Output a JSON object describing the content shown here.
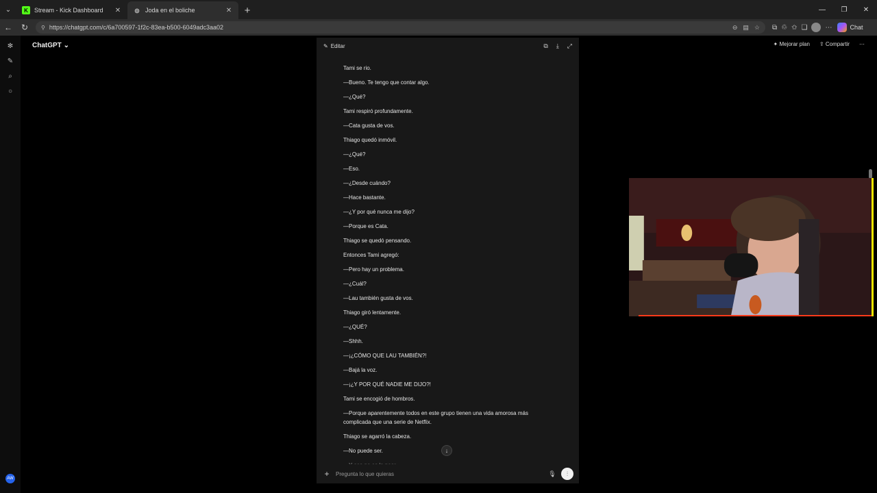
{
  "browser": {
    "tabs": [
      {
        "title": "Stream - Kick Dashboard",
        "favicon": "K",
        "favicon_color": "#53fc18"
      },
      {
        "title": "Joda en el boliche",
        "favicon": "◎",
        "favicon_color": "#d9d9d9"
      }
    ],
    "url": "https://chatgpt.com/c/6a700597-1f2c-83ea-b500-6049adc3aa02",
    "copilot_label": "Chat"
  },
  "app": {
    "name": "ChatGPT",
    "upgrade_label": "Mejorar plan",
    "share_label": "Compartir",
    "profile_initials": "AW"
  },
  "canvas": {
    "edit_label": "Editar",
    "paragraphs": [
      "Tami se rio.",
      "—Bueno. Te tengo que contar algo.",
      "—¿Qué?",
      "Tami respiró profundamente.",
      "—Cata gusta de vos.",
      "Thiago quedó inmóvil.",
      "—¿Qué?",
      "—Eso.",
      "—¿Desde cuándo?",
      "—Hace bastante.",
      "—¿Y por qué nunca me dijo?",
      "—Porque es Cata.",
      "Thiago se quedó pensando.",
      "Entonces Tami agregó:",
      "—Pero hay un problema.",
      "—¿Cuál?",
      "—Lau también gusta de vos.",
      "Thiago giró lentamente.",
      "—¿QUÉ?",
      "—Shhh.",
      "—¡¿CÓMO QUE LAU TAMBIÉN?!",
      "—Bajá la voz.",
      "—¡¿Y POR QUÉ NADIE ME DIJO?!",
      "Tami se encogió de hombros.",
      "—Porque aparentemente todos en este grupo tienen una vida amorosa más complicada que una serie de Netflix.",
      "Thiago se agarró la cabeza.",
      "—No puede ser.",
      "—Y eso no es lo peor."
    ],
    "composer_placeholder": "Pregunta lo que quieras"
  },
  "colors": {
    "webcam_border": "#f5e600",
    "webcam_underline": "#ff3a1a",
    "kick_green": "#53fc18"
  }
}
